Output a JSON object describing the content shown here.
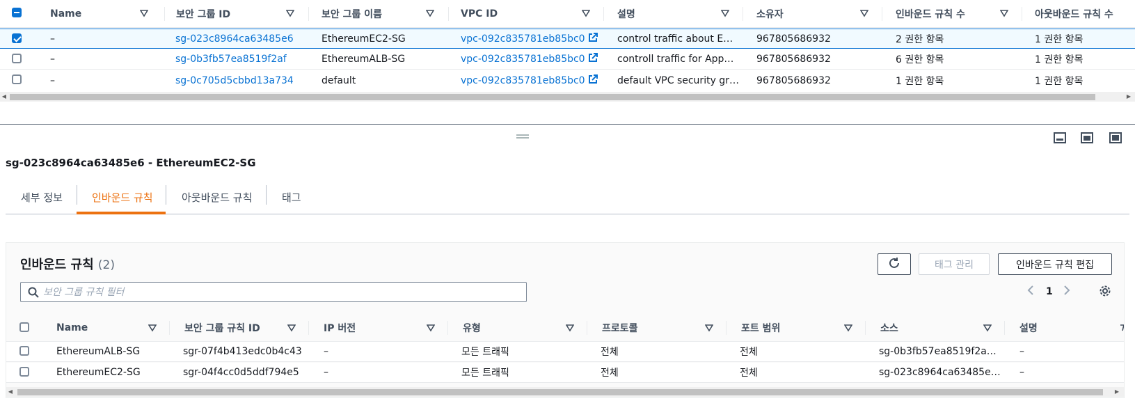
{
  "top_table": {
    "columns": [
      "Name",
      "보안 그룹 ID",
      "보안 그룹 이름",
      "VPC ID",
      "설명",
      "소유자",
      "인바운드 규칙 수",
      "아웃바운드 규칙 수"
    ],
    "rows": [
      {
        "selected": true,
        "name": "–",
        "sg_id": "sg-023c8964ca63485e6",
        "sg_name": "EthereumEC2-SG",
        "vpc_id": "vpc-092c835781eb85bc0",
        "desc": "control traffic about E…",
        "owner": "967805686932",
        "inbound": "2 권한 항목",
        "outbound": "1 권한 항목"
      },
      {
        "selected": false,
        "name": "–",
        "sg_id": "sg-0b3fb57ea8519f2af",
        "sg_name": "EthereumALB-SG",
        "vpc_id": "vpc-092c835781eb85bc0",
        "desc": "controll traffic for App…",
        "owner": "967805686932",
        "inbound": "6 권한 항목",
        "outbound": "1 권한 항목"
      },
      {
        "selected": false,
        "name": "–",
        "sg_id": "sg-0c705d5cbbd13a734",
        "sg_name": "default",
        "vpc_id": "vpc-092c835781eb85bc0",
        "desc": "default VPC security gr…",
        "owner": "967805686932",
        "inbound": "1 권한 항목",
        "outbound": "1 권한 항목"
      }
    ]
  },
  "details": {
    "title": "sg-023c8964ca63485e6 - EthereumEC2-SG",
    "tabs": [
      "세부 정보",
      "인바운드 규칙",
      "아웃바운드 규칙",
      "태그"
    ],
    "active_tab": "인바운드 규칙"
  },
  "inbound": {
    "title": "인바운드 규칙",
    "count": "(2)",
    "manage_tags_label": "태그 관리",
    "edit_label": "인바운드 규칙 편집",
    "search_placeholder": "보안 그룹 규칙 필터",
    "page": "1",
    "columns": [
      "Name",
      "보안 그룹 규칙 ID",
      "IP 버전",
      "유형",
      "프로토콜",
      "포트 범위",
      "소스",
      "설명"
    ],
    "rows": [
      {
        "name": "EthereumALB-SG",
        "rule_id": "sgr-07f4b413edc0b4c43",
        "ip": "–",
        "type": "모든 트래픽",
        "protocol": "전체",
        "port": "전체",
        "source": "sg-0b3fb57ea8519f2a…",
        "desc": "–"
      },
      {
        "name": "EthereumEC2-SG",
        "rule_id": "sgr-04f4cc0d5ddf794e5",
        "ip": "–",
        "type": "모든 트래픽",
        "protocol": "전체",
        "port": "전체",
        "source": "sg-023c8964ca63485e…",
        "desc": "–"
      }
    ]
  },
  "colors": {
    "accent": "#ec7211",
    "link": "#0972d3",
    "selected_bg": "#f1faff"
  }
}
